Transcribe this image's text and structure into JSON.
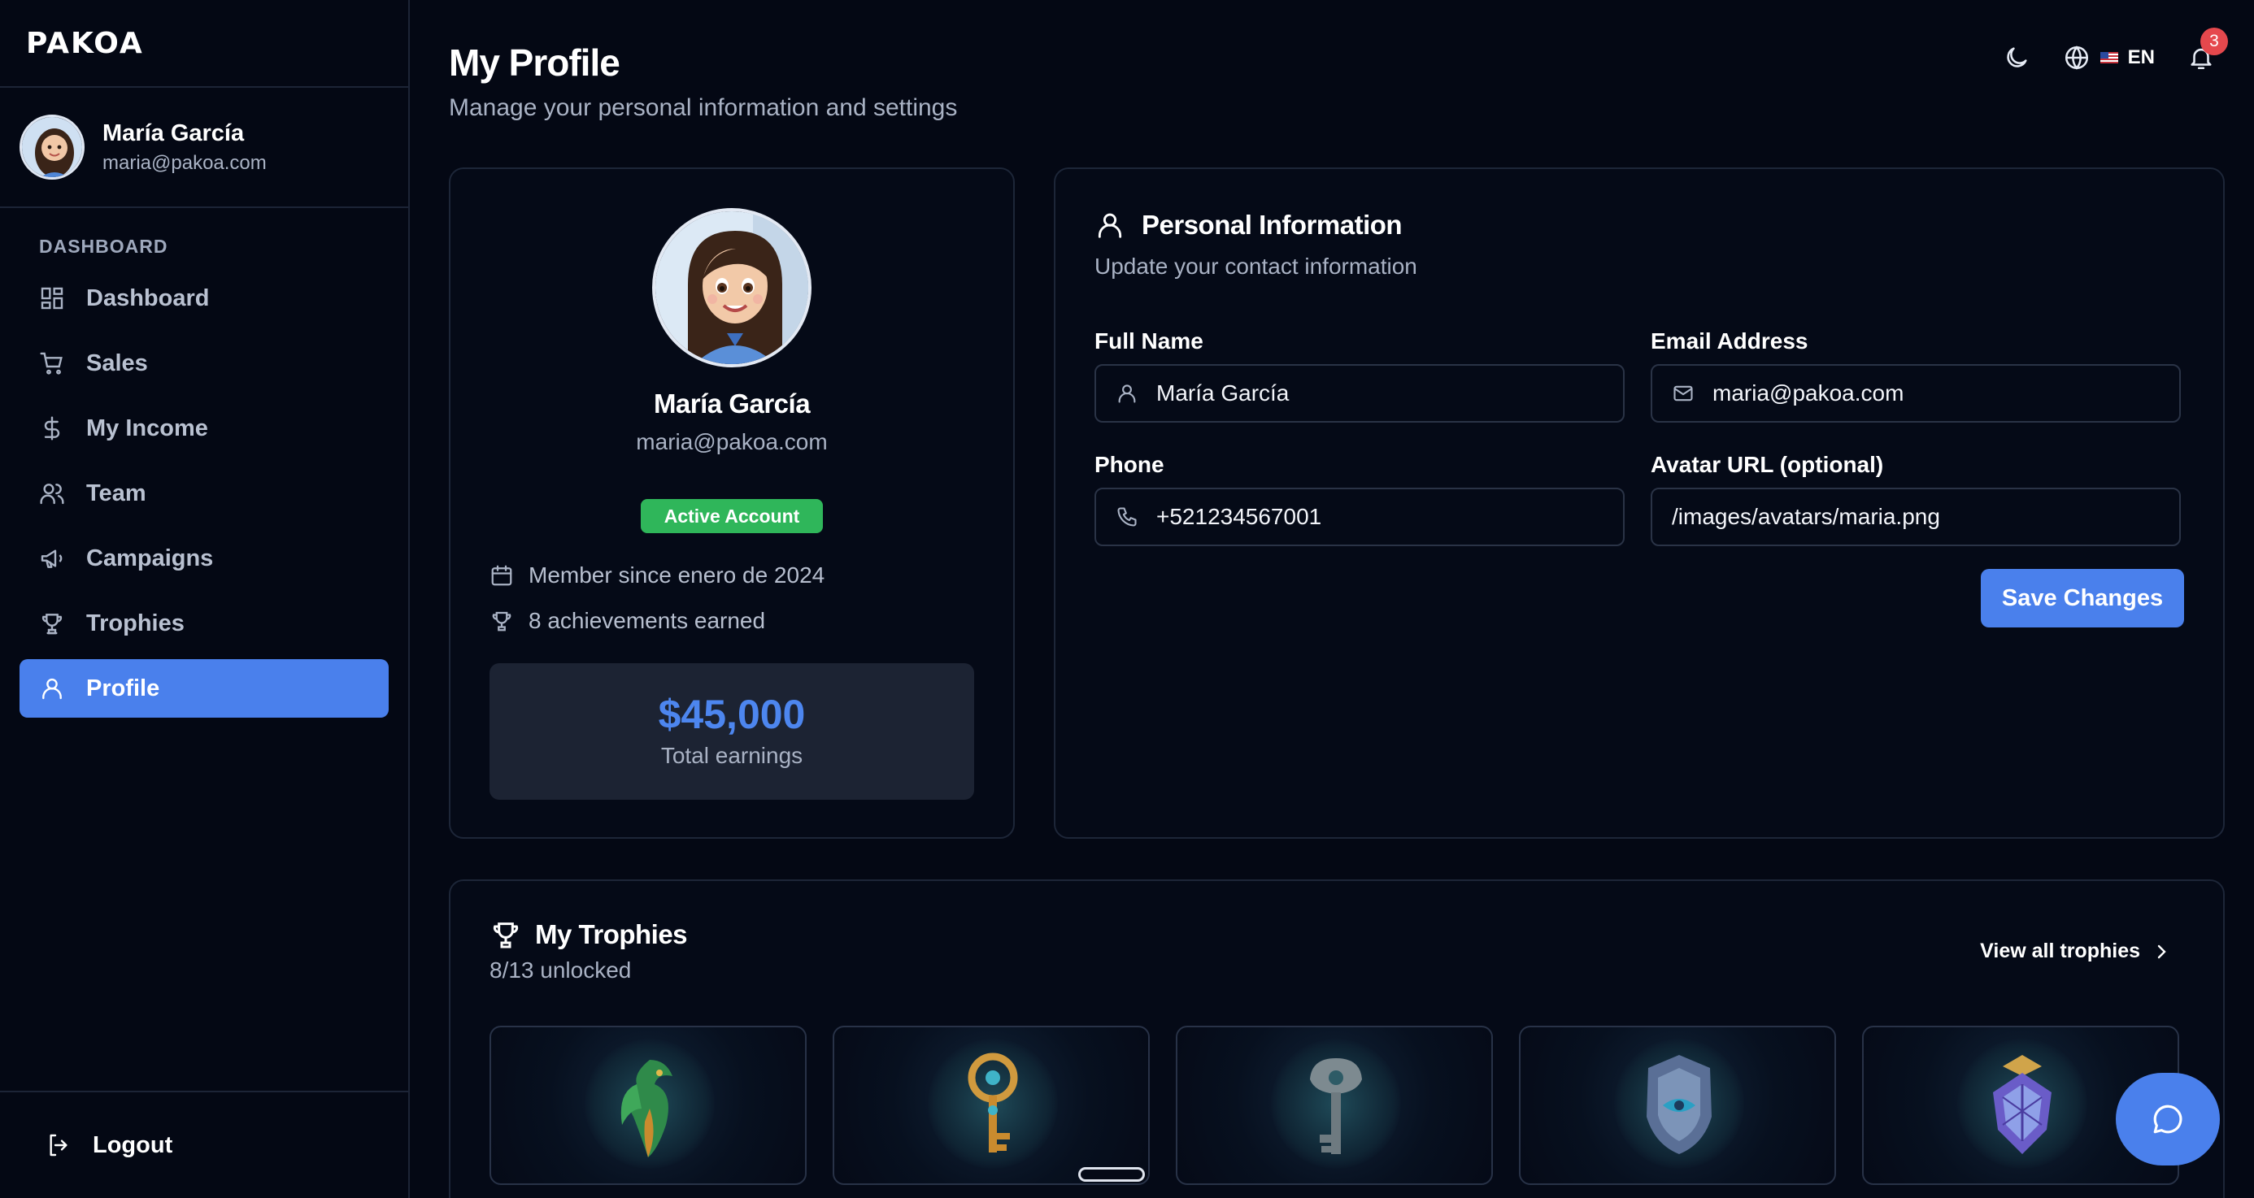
{
  "brand": {
    "logo_text": "PAKOA"
  },
  "user": {
    "name": "María García",
    "email": "maria@pakoa.com"
  },
  "sidebar": {
    "section_heading": "DASHBOARD",
    "items": [
      {
        "label": "Dashboard",
        "icon": "grid-icon"
      },
      {
        "label": "Sales",
        "icon": "cart-icon"
      },
      {
        "label": "My Income",
        "icon": "dollar-icon"
      },
      {
        "label": "Team",
        "icon": "users-icon"
      },
      {
        "label": "Campaigns",
        "icon": "megaphone-icon"
      },
      {
        "label": "Trophies",
        "icon": "trophy-icon"
      },
      {
        "label": "Profile",
        "icon": "user-icon",
        "active": true
      }
    ],
    "logout_label": "Logout"
  },
  "header": {
    "title": "My Profile",
    "subtitle": "Manage your personal information and settings",
    "language_code": "EN",
    "notification_count": "3"
  },
  "profile_card": {
    "name": "María García",
    "email": "maria@pakoa.com",
    "status_badge": "Active Account",
    "member_since": "Member since enero de 2024",
    "achievements": "8 achievements earned",
    "earnings_value": "$45,000",
    "earnings_label": "Total earnings"
  },
  "personal_info": {
    "title": "Personal Information",
    "subtitle": "Update your contact information",
    "fields": {
      "full_name": {
        "label": "Full Name",
        "value": "María García"
      },
      "email": {
        "label": "Email Address",
        "value": "maria@pakoa.com"
      },
      "phone": {
        "label": "Phone",
        "value": "+521234567001"
      },
      "avatar_url": {
        "label": "Avatar URL (optional)",
        "value": "/images/avatars/maria.png"
      }
    },
    "save_label": "Save Changes"
  },
  "trophies": {
    "title": "My Trophies",
    "subtitle": "8/13 unlocked",
    "view_all_label": "View all trophies",
    "items": [
      "phoenix-trophy",
      "golden-key-trophy",
      "silver-key-trophy",
      "shield-trophy",
      "crystal-crest-trophy"
    ]
  },
  "colors": {
    "background": "#040814",
    "accent": "#4a80ec",
    "success": "#2fb65a",
    "danger": "#e5484d",
    "earnings": "#4d86ef"
  }
}
